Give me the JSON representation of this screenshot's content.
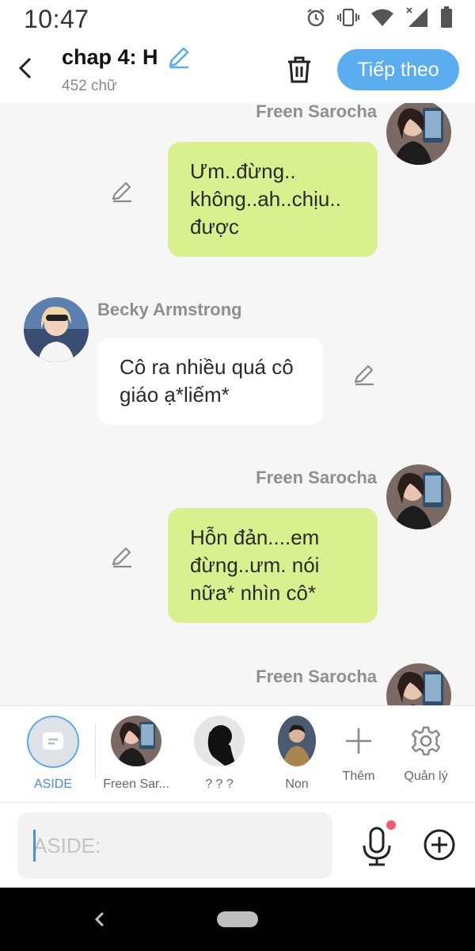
{
  "status_bar": {
    "time": "10:47"
  },
  "header": {
    "title": "chap 4: H",
    "word_count": "452 chữ",
    "next_label": "Tiếp theo"
  },
  "messages": [
    {
      "speaker": "Freen Sarocha",
      "side": "right",
      "text": "Ưm..đừng.. không..ah..chịu.. được"
    },
    {
      "speaker": "Becky Armstrong",
      "side": "left",
      "text": "Cô ra nhiều quá cô giáo ạ*liếm*"
    },
    {
      "speaker": "Freen Sarocha",
      "side": "right",
      "text": "Hỗn đản....em đừng..ưm. nói nữa* nhìn cô*"
    },
    {
      "speaker": "Freen Sarocha",
      "side": "right",
      "text": ""
    }
  ],
  "characters": [
    {
      "label": "ASIDE"
    },
    {
      "label": "Freen Sar..."
    },
    {
      "label": "? ? ?"
    },
    {
      "label": "Non"
    },
    {
      "label": "Thêm"
    },
    {
      "label": "Quản lý"
    }
  ],
  "input": {
    "placeholder": "ASIDE:"
  },
  "colors": {
    "accent": "#5aaef0",
    "bubble_right": "#d8f08e",
    "bubble_left": "#ffffff",
    "chat_bg": "#f6f6f6"
  },
  "icons": [
    "back-arrow",
    "edit-pencil",
    "trash",
    "mic",
    "add-circle",
    "gear",
    "plus"
  ]
}
